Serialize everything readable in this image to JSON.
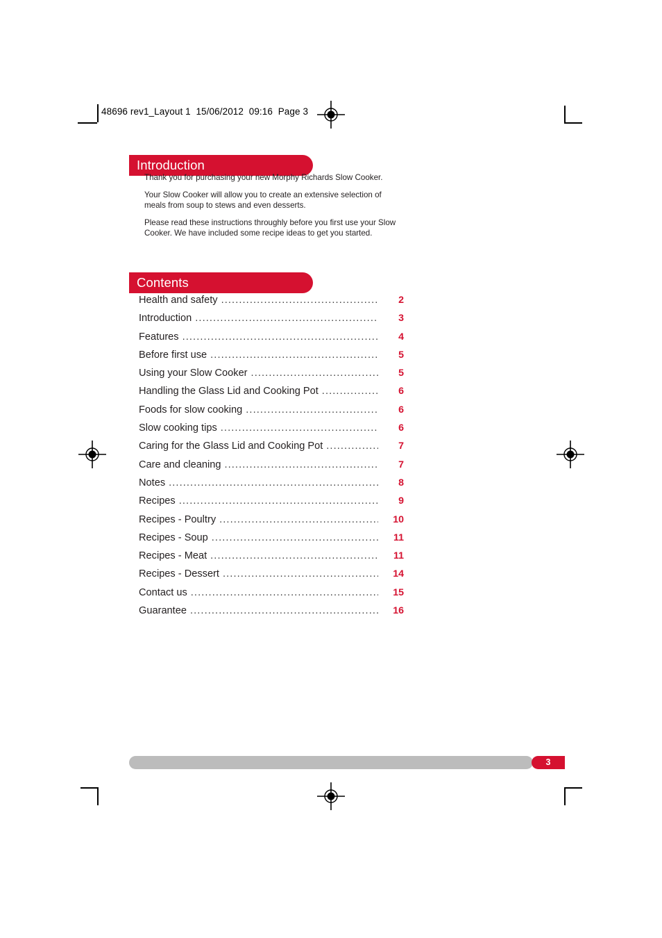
{
  "prepress": {
    "slug": "48696 rev1_Layout 1  15/06/2012  09:16  Page 3",
    "marks": {
      "registration_icon": "registration-target-icon",
      "crop_icon": "crop-mark-icon"
    }
  },
  "intro": {
    "heading": "Introduction",
    "paragraphs": [
      "Thank you for purchasing your new Morphy Richards Slow Cooker.",
      "Your Slow Cooker will allow you to create an extensive selection of meals from soup to stews and even desserts.",
      "Please read these instructions throughly before you first use your Slow Cooker. We have included some recipe ideas to get you started."
    ]
  },
  "contents": {
    "heading": "Contents",
    "leader": "...................................................................................................",
    "entries": [
      {
        "label": "Health and safety",
        "page": "2"
      },
      {
        "label": "Introduction",
        "page": "3"
      },
      {
        "label": "Features",
        "page": "4"
      },
      {
        "label": "Before first use",
        "page": "5"
      },
      {
        "label": "Using your Slow Cooker",
        "page": "5"
      },
      {
        "label": "Handling the Glass Lid and Cooking Pot",
        "page": "6"
      },
      {
        "label": "Foods for slow cooking",
        "page": "6"
      },
      {
        "label": "Slow cooking tips",
        "page": "6"
      },
      {
        "label": "Caring for the Glass Lid and Cooking Pot",
        "page": "7"
      },
      {
        "label": "Care and cleaning",
        "page": "7"
      },
      {
        "label": "Notes",
        "page": "8"
      },
      {
        "label": "Recipes",
        "page": "9"
      },
      {
        "label": "Recipes - Poultry",
        "page": "10"
      },
      {
        "label": "Recipes - Soup",
        "page": "11"
      },
      {
        "label": "Recipes - Meat",
        "page": "11"
      },
      {
        "label": "Recipes - Dessert",
        "page": "14"
      },
      {
        "label": "Contact us",
        "page": "15"
      },
      {
        "label": "Guarantee",
        "page": "16"
      }
    ]
  },
  "footer": {
    "page_number": "3"
  },
  "colors": {
    "accent_red": "#d51130",
    "footer_grey": "#bcbcbc",
    "body_text": "#231f20"
  }
}
